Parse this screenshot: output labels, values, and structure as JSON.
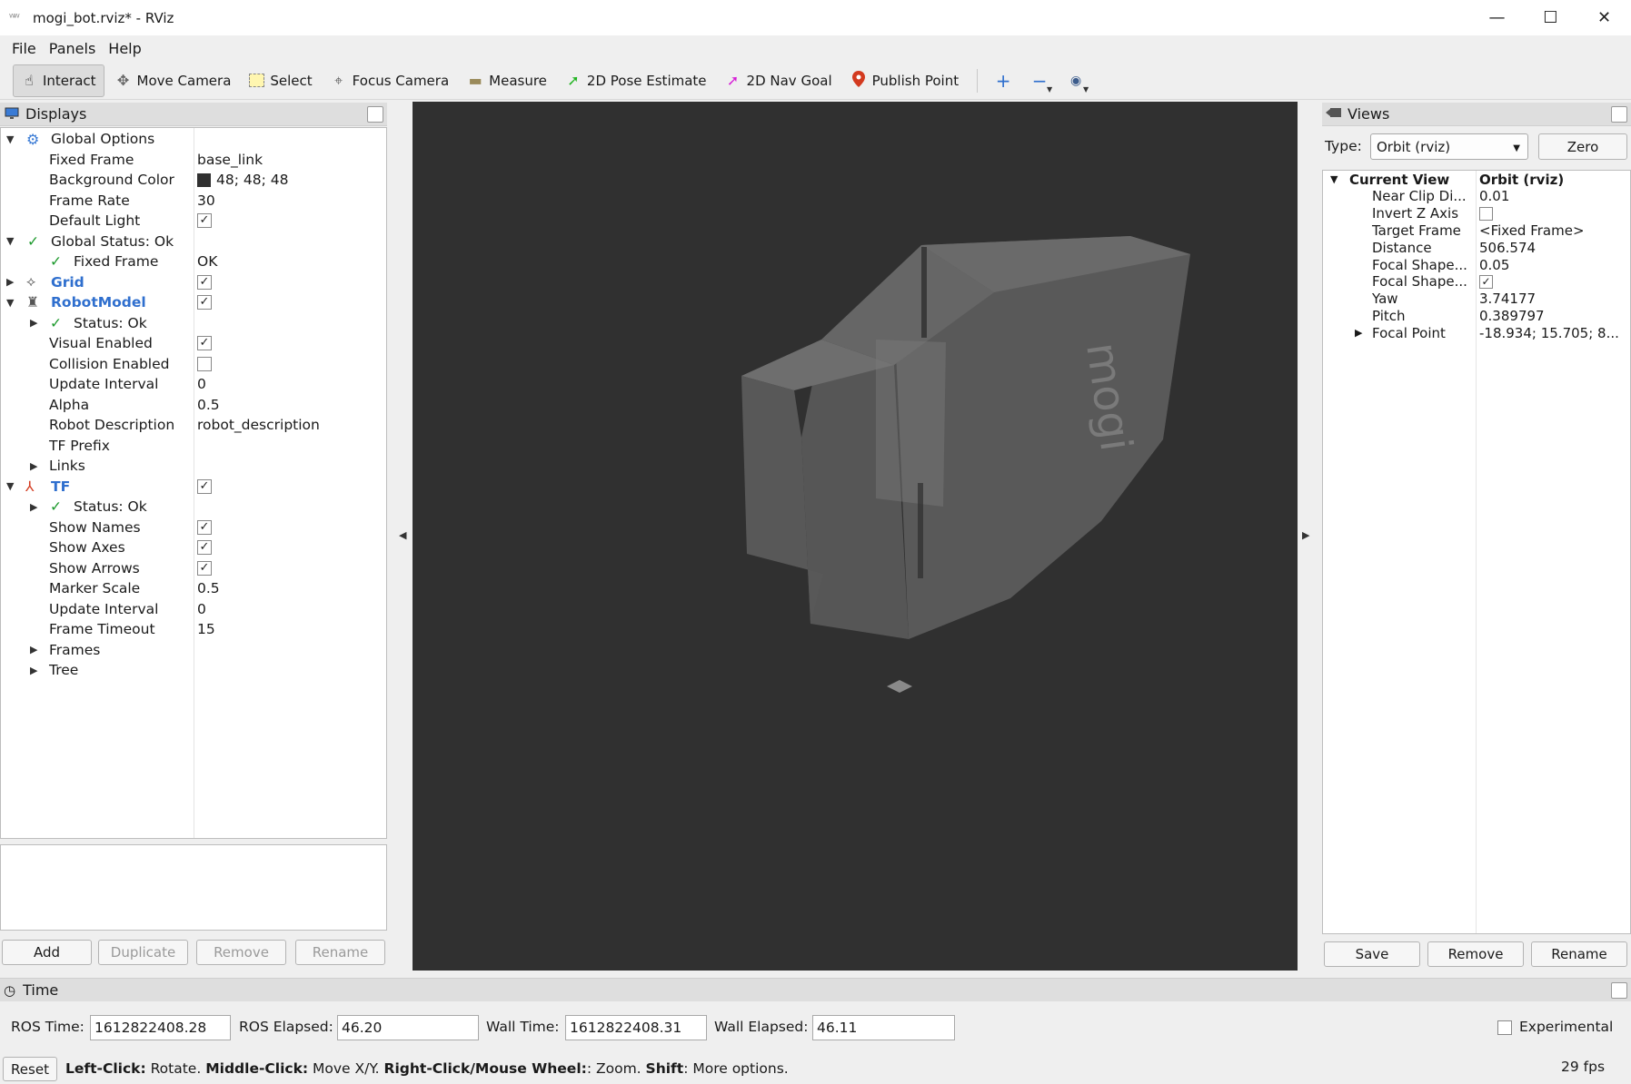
{
  "window": {
    "title": "mogi_bot.rviz* - RViz",
    "minimize": "—",
    "maximize": "☐",
    "close": "✕"
  },
  "menu": [
    "File",
    "Panels",
    "Help"
  ],
  "toolbar": {
    "tools": [
      {
        "label": "Interact",
        "icon": "hand-cursor-icon",
        "glyph": "☝",
        "active": true
      },
      {
        "label": "Move Camera",
        "icon": "move-camera-icon",
        "glyph": "✥",
        "active": false
      },
      {
        "label": "Select",
        "icon": "select-icon",
        "glyph": "▭",
        "active": false
      },
      {
        "label": "Focus Camera",
        "icon": "focus-camera-icon",
        "glyph": "⌖",
        "active": false
      },
      {
        "label": "Measure",
        "icon": "measure-icon",
        "glyph": "▬",
        "active": false
      },
      {
        "label": "2D Pose Estimate",
        "icon": "pose-estimate-icon",
        "glyph": "➚",
        "active": false
      },
      {
        "label": "2D Nav Goal",
        "icon": "nav-goal-icon",
        "glyph": "➚",
        "active": false
      },
      {
        "label": "Publish Point",
        "icon": "publish-point-icon",
        "glyph": "●",
        "active": false
      }
    ],
    "colors": {
      "pose": "#22b422",
      "nav": "#d61fd6",
      "point": "#d33a1f"
    }
  },
  "displays": {
    "title": "Displays",
    "rows": {
      "global_options": "Global Options",
      "fixed_frame_label": "Fixed Frame",
      "fixed_frame_value": "base_link",
      "bg_color_label": "Background Color",
      "bg_color_value": "48; 48; 48",
      "frame_rate_label": "Frame Rate",
      "frame_rate_value": "30",
      "default_light_label": "Default Light",
      "global_status": "Global Status: Ok",
      "gs_fixed_frame_label": "Fixed Frame",
      "gs_fixed_frame_value": "OK",
      "grid": "Grid",
      "robot_model": "RobotModel",
      "rm_status": "Status: Ok",
      "visual_enabled": "Visual Enabled",
      "collision_enabled": "Collision Enabled",
      "rm_update_interval_label": "Update Interval",
      "rm_update_interval_value": "0",
      "alpha_label": "Alpha",
      "alpha_value": "0.5",
      "robot_desc_label": "Robot Description",
      "robot_desc_value": "robot_description",
      "tf_prefix": "TF Prefix",
      "links": "Links",
      "tf": "TF",
      "tf_status": "Status: Ok",
      "show_names": "Show Names",
      "show_axes": "Show Axes",
      "show_arrows": "Show Arrows",
      "marker_scale_label": "Marker Scale",
      "marker_scale_value": "0.5",
      "tf_update_interval_label": "Update Interval",
      "tf_update_interval_value": "0",
      "frame_timeout_label": "Frame Timeout",
      "frame_timeout_value": "15",
      "frames": "Frames",
      "tree": "Tree"
    },
    "checked": {
      "default_light": true,
      "grid": true,
      "robot_model": true,
      "visual_enabled": true,
      "collision_enabled": false,
      "tf": true,
      "show_names": true,
      "show_axes": true,
      "show_arrows": true
    },
    "buttons": {
      "add": "Add",
      "duplicate": "Duplicate",
      "remove": "Remove",
      "rename": "Rename"
    }
  },
  "views": {
    "title": "Views",
    "type_label": "Type:",
    "type_value": "Orbit (rviz)",
    "zero": "Zero",
    "current_view_label": "Current View",
    "current_view_value": "Orbit (rviz)",
    "props": [
      {
        "label": "Near Clip Di...",
        "value": "0.01"
      },
      {
        "label": "Invert Z Axis",
        "value": ""
      },
      {
        "label": "Target Frame",
        "value": "<Fixed Frame>"
      },
      {
        "label": "Distance",
        "value": "506.574"
      },
      {
        "label": "Focal Shape...",
        "value": "0.05"
      },
      {
        "label": "Focal Shape...",
        "value": ""
      },
      {
        "label": "Yaw",
        "value": "3.74177"
      },
      {
        "label": "Pitch",
        "value": "0.389797"
      },
      {
        "label": "Focal Point",
        "value": "-18.934; 15.705; 8..."
      }
    ],
    "invert_z_checked": false,
    "focal_shape_fixed_checked": true,
    "buttons": {
      "save": "Save",
      "remove": "Remove",
      "rename": "Rename"
    }
  },
  "time": {
    "title": "Time",
    "ros_time_label": "ROS Time:",
    "ros_time": "1612822408.28",
    "ros_elapsed_label": "ROS Elapsed:",
    "ros_elapsed": "46.20",
    "wall_time_label": "Wall Time:",
    "wall_time": "1612822408.31",
    "wall_elapsed_label": "Wall Elapsed:",
    "wall_elapsed": "46.11",
    "experimental": "Experimental"
  },
  "status": {
    "reset": "Reset",
    "hint_left_click": "Left-Click:",
    "hint_rotate": " Rotate. ",
    "hint_middle_click": "Middle-Click:",
    "hint_move": " Move X/Y. ",
    "hint_right_click": "Right-Click/Mouse Wheel:",
    "hint_zoom": ": Zoom. ",
    "hint_shift": "Shift",
    "hint_more": ": More options.",
    "fps": "29 fps"
  }
}
